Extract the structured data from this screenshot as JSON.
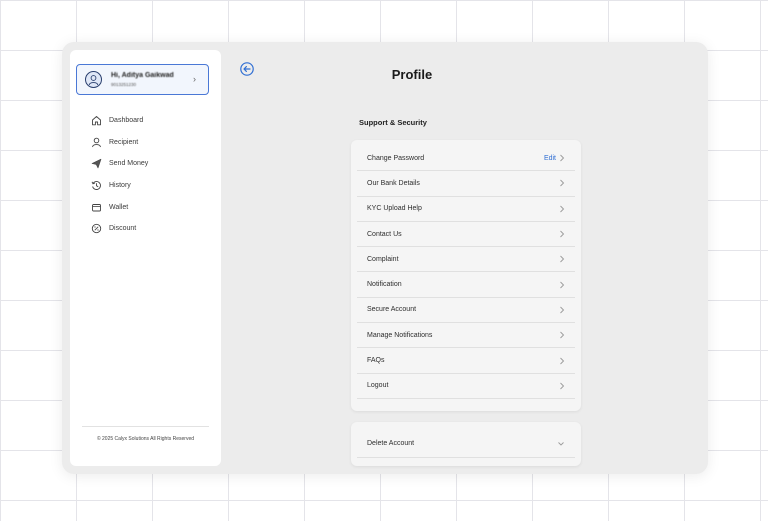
{
  "sidebar": {
    "user": {
      "greeting": "Hi, Aditya Gaikwad",
      "phone": "9013251230"
    },
    "items": [
      {
        "label": "Dashboard",
        "icon": "home-icon"
      },
      {
        "label": "Recipient",
        "icon": "user-icon"
      },
      {
        "label": "Send Money",
        "icon": "send-icon"
      },
      {
        "label": "History",
        "icon": "history-icon"
      },
      {
        "label": "Wallet",
        "icon": "wallet-icon"
      },
      {
        "label": "Discount",
        "icon": "discount-icon"
      }
    ],
    "copyright": "© 2025 Calyx Solutions All Rights Reserved"
  },
  "header": {
    "title": "Profile"
  },
  "support": {
    "title": "Support & Security",
    "items": [
      {
        "label": "Change Password",
        "action": "Edit"
      },
      {
        "label": "Our Bank Details"
      },
      {
        "label": "KYC Upload Help"
      },
      {
        "label": "Contact Us"
      },
      {
        "label": "Complaint"
      },
      {
        "label": "Notification"
      },
      {
        "label": "Secure Account"
      },
      {
        "label": "Manage Notifications"
      },
      {
        "label": "FAQs"
      },
      {
        "label": "Logout"
      }
    ]
  },
  "danger": {
    "delete_label": "Delete Account"
  },
  "colors": {
    "accent": "#2f6ed3",
    "frame_bg": "#ececec",
    "card_bg": "#f5f5f5"
  }
}
